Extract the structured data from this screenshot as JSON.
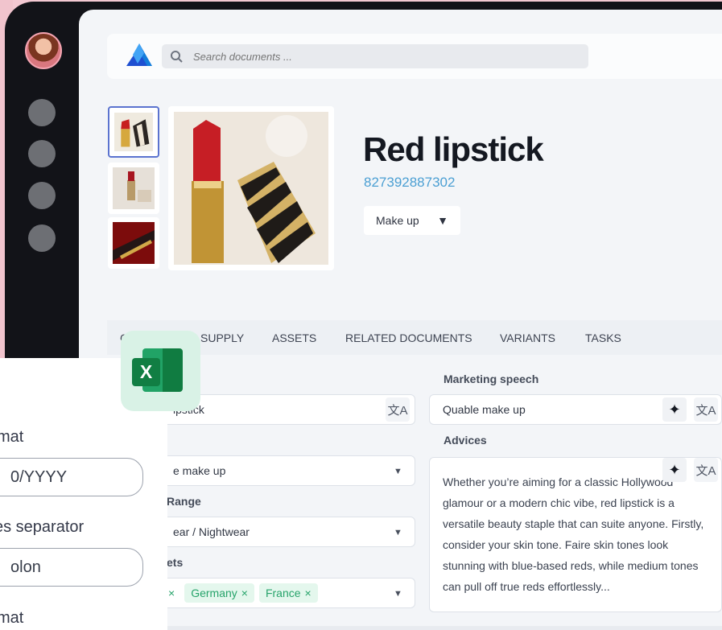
{
  "search": {
    "placeholder": "Search documents ..."
  },
  "product": {
    "title": "Red lipstick",
    "code": "827392887302",
    "category": "Make up"
  },
  "tabs": {
    "partial_first": "C",
    "items": [
      "SUPPLY",
      "ASSETS",
      "RELATED DOCUMENTS",
      "VARIANTS",
      "TASKS"
    ]
  },
  "fields": {
    "left": {
      "name_value": "ipstick",
      "category_value": "e make up",
      "range_label": "Range",
      "range_value": "ear / Nightwear",
      "markets_label": "ets",
      "markets": [
        "Germany",
        "France"
      ]
    },
    "marketing": {
      "label": "Marketing speech",
      "value": "Quable make up"
    },
    "advices": {
      "label": "Advices",
      "text": "Whether you’re aiming for a classic Hollywood glamour or a modern chic vibe, red lipstick is a versatile beauty staple that can suite anyone. Firstly, consider your skin tone. Faire skin tones look stunning with blue-based reds, while medium tones can pull off true reds effortlessly..."
    }
  },
  "export_panel": {
    "top_partial": "t",
    "date_format_label": "mat",
    "date_format_value": "0/YYYY",
    "separator_label": "es separator",
    "separator_value": "olon",
    "format_label": "mat"
  },
  "colors": {
    "accent_blue": "#4b9fd3",
    "chip_green": "#26a36a",
    "excel_green": "#107c41"
  },
  "icons": {
    "logo": "company-logo-icon",
    "search": "search-icon",
    "translate": "translate-icon",
    "ai": "ai-sparkle-icon",
    "excel": "excel-icon"
  }
}
